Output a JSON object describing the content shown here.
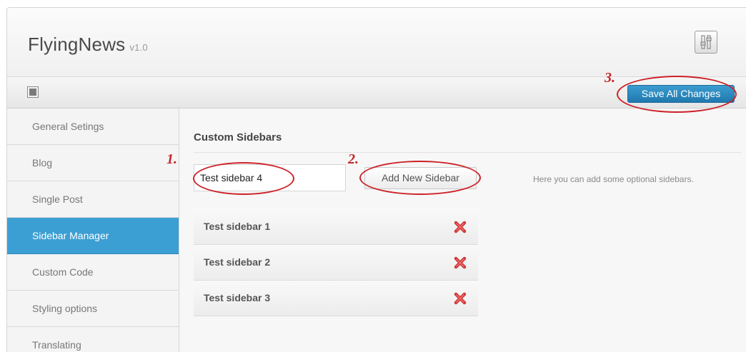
{
  "app": {
    "name": "FlyingNews",
    "version": "v1.0"
  },
  "toolbar": {
    "save_label": "Save All Changes"
  },
  "sidebar": {
    "items": [
      {
        "label": "General Setings",
        "active": false
      },
      {
        "label": "Blog",
        "active": false
      },
      {
        "label": "Single Post",
        "active": false
      },
      {
        "label": "Sidebar Manager",
        "active": true
      },
      {
        "label": "Custom Code",
        "active": false
      },
      {
        "label": "Styling options",
        "active": false
      },
      {
        "label": "Translating",
        "active": false
      }
    ]
  },
  "main": {
    "section_title": "Custom Sidebars",
    "input_value": "Test sidebar 4",
    "add_button_label": "Add New Sidebar",
    "help_text": "Here you can add some optional sidebars.",
    "sidebars": [
      {
        "label": "Test sidebar 1"
      },
      {
        "label": "Test sidebar 2"
      },
      {
        "label": "Test sidebar 3"
      }
    ]
  },
  "annotations": {
    "step1": "1.",
    "step2": "2.",
    "step3": "3."
  },
  "colors": {
    "accent": "#3c9fd3",
    "annotation": "#c8262a",
    "remove_icon": "#d23a3a"
  },
  "icons": {
    "settings": "settings-sliders-icon",
    "collapse": "collapse-icon",
    "remove": "remove-x-icon"
  }
}
